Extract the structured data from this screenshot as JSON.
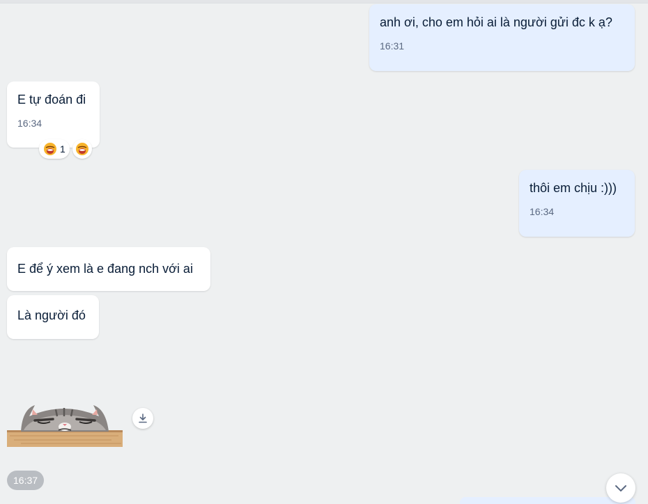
{
  "messages": [
    {
      "text": "anh ơi, cho em hỏi ai là người gửi đc k ạ?",
      "time": "16:31",
      "side": "me"
    },
    {
      "text": "E tự đoán đi",
      "time": "16:34",
      "side": "them",
      "reactions": [
        {
          "emoji": "laughing-face",
          "count": "1"
        },
        {
          "emoji": "laughing-face"
        }
      ]
    },
    {
      "text": "thôi em chịu :)))",
      "time": "16:34",
      "side": "me"
    },
    {
      "text": "E để ý xem là e đang nch với ai",
      "side": "them"
    },
    {
      "text": "Là người đó",
      "side": "them"
    }
  ],
  "sticker": {
    "name": "cat-peeking-sticker"
  },
  "sticker_time": "16:37",
  "colors": {
    "me_bubble": "#e5efff",
    "them_bubble": "#ffffff",
    "background": "#eef0f1"
  }
}
